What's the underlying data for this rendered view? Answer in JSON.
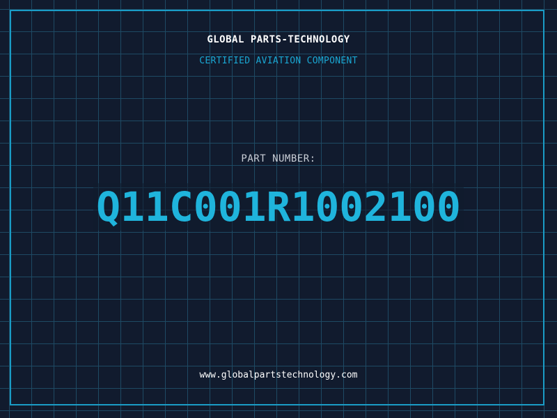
{
  "header": {
    "company": "GLOBAL PARTS-TECHNOLOGY",
    "subtitle": "CERTIFIED AVIATION COMPONENT"
  },
  "part": {
    "label": "PART NUMBER:",
    "number": "Q11C001R1002100"
  },
  "footer": {
    "website": "www.globalpartstechnology.com"
  },
  "colors": {
    "background": "#111b2e",
    "grid": "#1e4a64",
    "accent": "#1fb4dc",
    "frame": "#1a9cc6"
  }
}
